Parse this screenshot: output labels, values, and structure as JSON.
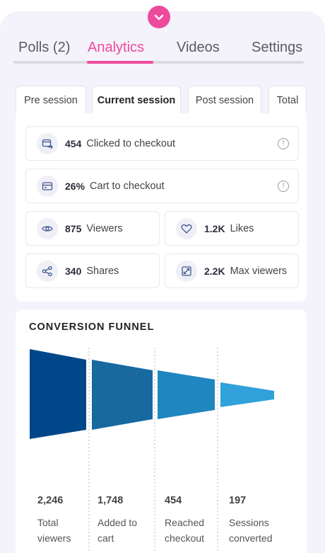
{
  "tabs": [
    {
      "label": "Polls (2)",
      "active": false
    },
    {
      "label": "Analytics",
      "active": true
    },
    {
      "label": "Videos",
      "active": false
    },
    {
      "label": "Settings",
      "active": false
    }
  ],
  "session_tabs": [
    {
      "label": "Pre session",
      "active": false
    },
    {
      "label": "Current session",
      "active": true
    },
    {
      "label": "Post session",
      "active": false
    },
    {
      "label": "Total",
      "active": false
    }
  ],
  "stats": {
    "clicked_checkout": {
      "value": "454",
      "label": "Clicked to checkout",
      "icon": "checkout-icon"
    },
    "cart_checkout": {
      "value": "26%",
      "label": "Cart to checkout",
      "icon": "card-icon"
    },
    "viewers": {
      "value": "875",
      "label": "Viewers",
      "icon": "eye-icon"
    },
    "likes": {
      "value": "1.2K",
      "label": "Likes",
      "icon": "heart-icon"
    },
    "shares": {
      "value": "340",
      "label": "Shares",
      "icon": "share-icon"
    },
    "max_viewers": {
      "value": "2.2K",
      "label": "Max viewers",
      "icon": "expand-icon"
    },
    "info_glyph": "!"
  },
  "funnel": {
    "title": "CONVERSION FUNNEL",
    "stages": [
      {
        "value": "2,246",
        "label": "Total viewers",
        "color": "#00478a"
      },
      {
        "value": "1,748",
        "label": "Added to cart",
        "color": "#1769a0"
      },
      {
        "value": "454",
        "label": "Reached checkout",
        "color": "#2086bf"
      },
      {
        "value": "197",
        "label": "Sessions converted",
        "color": "#30a1da"
      }
    ]
  },
  "colors": {
    "accent": "#ee4a9c",
    "panel_bg": "#f4f2fb"
  }
}
